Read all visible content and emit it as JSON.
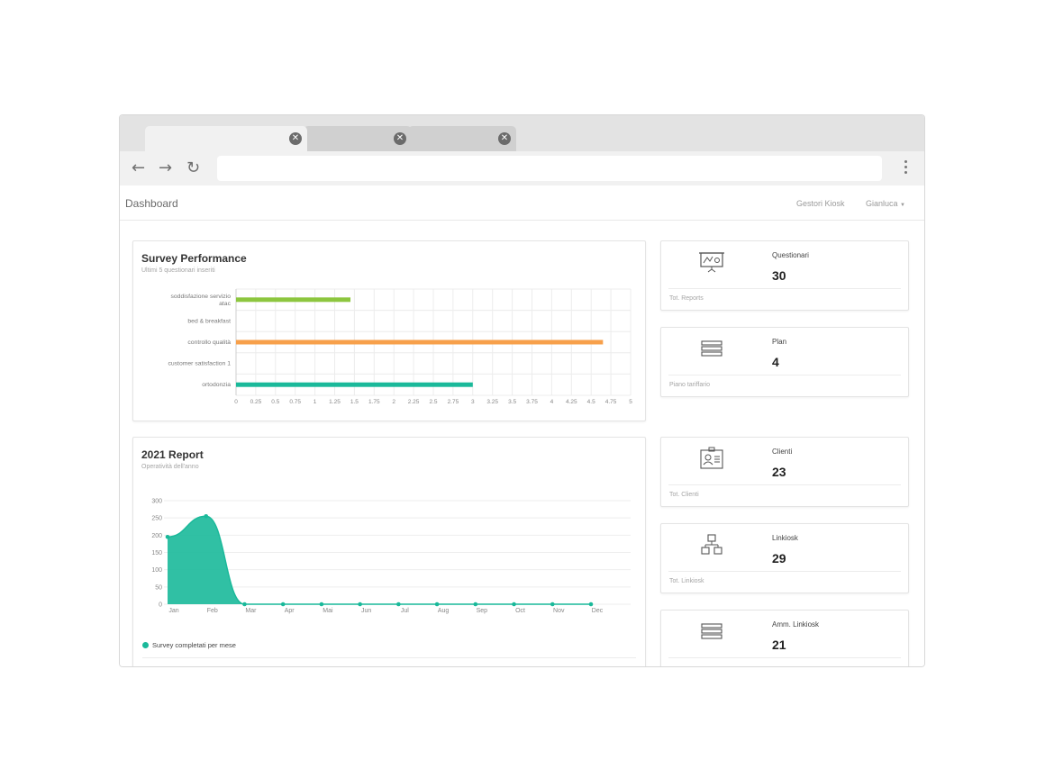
{
  "browser": {
    "tabs": [
      {
        "close": "✕"
      },
      {
        "close": "✕"
      },
      {
        "close": "✕"
      }
    ],
    "back_icon": "arrow-left-icon",
    "forward_icon": "arrow-right-icon",
    "reload_icon": "reload-icon",
    "menu_icon": "kebab-menu-icon",
    "url": ""
  },
  "nav": {
    "brand": "Dashboard",
    "links": [
      "Gestori Kiosk",
      "Gianluca"
    ]
  },
  "survey": {
    "title": "Survey Performance",
    "subtitle": "Ultimi 5 questionari inseriti"
  },
  "report": {
    "title": "2021 Report",
    "subtitle": "Operatività dell'anno",
    "legend": "Survey completati per mese"
  },
  "stats": [
    {
      "label": "Questionari",
      "value": "30",
      "footer": "Tot. Reports",
      "icon": "presentation-board-icon"
    },
    {
      "label": "Plan",
      "value": "4",
      "footer": "Piano tariffario",
      "icon": "stack-list-icon"
    },
    {
      "label": "Clienti",
      "value": "23",
      "footer": "Tot. Clienti",
      "icon": "id-card-icon"
    },
    {
      "label": "Linkiosk",
      "value": "29",
      "footer": "Tot. Linkiosk",
      "icon": "network-icon"
    },
    {
      "label": "Amm. Linkiosk",
      "value": "21",
      "footer": "",
      "icon": "stack-list-icon"
    }
  ],
  "colors": {
    "green": "#8dc63f",
    "orange": "#f7a04b",
    "teal": "#1ab99a"
  },
  "chart_data": [
    {
      "type": "bar",
      "orientation": "horizontal",
      "categories": [
        "soddisfazione servizio atac",
        "bed & breakfast",
        "controllo qualità",
        "customer satisfaction 1",
        "ortodonzia"
      ],
      "category_lines": [
        [
          "soddisfazione servizio",
          "atac"
        ],
        [
          "bed & breakfast"
        ],
        [
          "controllo qualità"
        ],
        [
          "customer satisfaction 1"
        ],
        [
          "ortodonzia"
        ]
      ],
      "values": [
        1.45,
        0,
        4.65,
        0,
        3.0
      ],
      "bar_colors": [
        "#8dc63f",
        null,
        "#f7a04b",
        null,
        "#1ab99a"
      ],
      "xlim": [
        0,
        5
      ],
      "xticks": [
        "0",
        "0.25",
        "0.5",
        "0.75",
        "1",
        "1.25",
        "1.5",
        "1.75",
        "2",
        "2.25",
        "2.5",
        "2.75",
        "3",
        "3.25",
        "3.5",
        "3.75",
        "4",
        "4.25",
        "4.5",
        "4.75",
        "5"
      ],
      "grid": true
    },
    {
      "type": "area",
      "categories": [
        "Jan",
        "Feb",
        "Mar",
        "Apr",
        "Mai",
        "Jun",
        "Jul",
        "Aug",
        "Sep",
        "Oct",
        "Nov",
        "Dec"
      ],
      "series": [
        {
          "name": "Survey completati per mese",
          "values": [
            195,
            255,
            0,
            0,
            0,
            0,
            0,
            0,
            0,
            0,
            0,
            0
          ]
        }
      ],
      "ylim": [
        0,
        300
      ],
      "yticks": [
        "0",
        "50",
        "100",
        "150",
        "200",
        "250",
        "300"
      ],
      "grid": true,
      "legend": "bottom-left"
    }
  ]
}
